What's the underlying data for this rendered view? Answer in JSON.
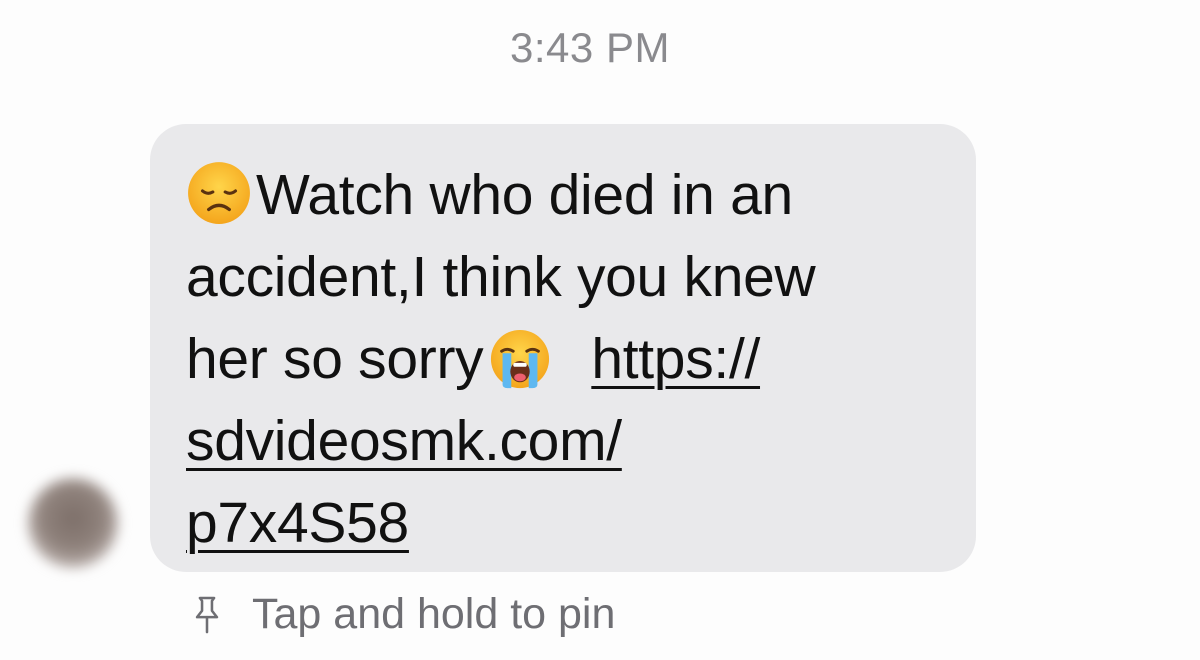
{
  "conversation": {
    "timestamp": "3:43 PM"
  },
  "message": {
    "line1_text": "Watch who died in an",
    "line2_text": "accident,I think you knew",
    "line3_text": "her so sorry",
    "link_line1": "https://",
    "link_line2": "sdvideosmk.com/",
    "link_line3": "p7x4S58",
    "leading_emoji_icon": "disappointed-face-emoji",
    "trailing_emoji_icon": "loudly-crying-face-emoji"
  },
  "hint": {
    "icon": "pin-icon",
    "label": "Tap and hold to pin"
  },
  "colors": {
    "bubble_background": "#e9e9eb",
    "timestamp_text": "#8a8a8e",
    "hint_text": "#6e6e73"
  }
}
